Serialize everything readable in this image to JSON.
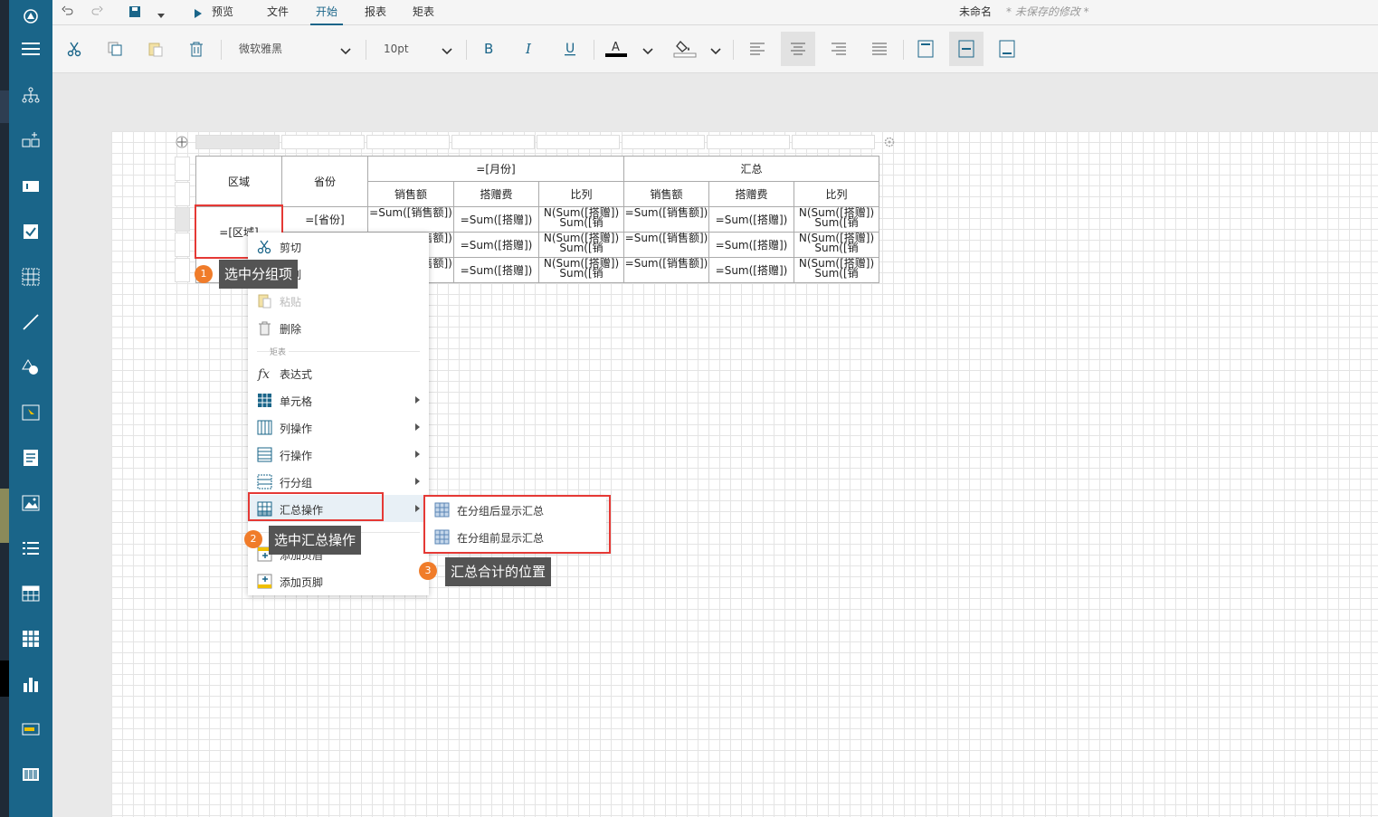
{
  "menubar": {
    "preview": "预览",
    "tabs": [
      "文件",
      "开始",
      "报表",
      "矩表"
    ],
    "doc_name": "未命名",
    "unsaved": "* 未保存的修改 *"
  },
  "toolbar": {
    "font_family": "微软雅黑",
    "font_size": "10pt",
    "accent": "#1a6589"
  },
  "sidebar": {
    "items": [
      "logo-icon",
      "menu-icon",
      "hierarchy-icon",
      "add-grid-icon",
      "textbox-icon",
      "checkbox-icon",
      "table-icon",
      "line-icon",
      "shapes-icon",
      "cursor-icon",
      "document-icon",
      "image-icon",
      "list-icon",
      "tablix-icon",
      "matrix-icon",
      "bar-chart-icon",
      "bullet-icon",
      "barcode-icon"
    ]
  },
  "matrix": {
    "header_region": "区域",
    "header_province": "省份",
    "header_month": "=[月份]",
    "header_total": "汇总",
    "sub_headers": [
      "销售额",
      "搭赠费",
      "比列",
      "销售额",
      "搭赠费",
      "比列"
    ],
    "cell_region": "=[区域]",
    "cell_province": "=[省份]",
    "cell_sales": "=Sum([销售额])",
    "cell_gift": "=Sum([搭赠])",
    "cell_ratio": "N(Sum([搭赠]) Sum([销"
  },
  "context_menu": {
    "cut": "剪切",
    "copy": "复制",
    "paste": "粘贴",
    "delete": "删除",
    "section_matrix": "矩表",
    "expression": "表达式",
    "cell": "单元格",
    "column_ops": "列操作",
    "row_ops": "行操作",
    "row_group": "行分组",
    "total_ops": "汇总操作",
    "section_report": "报表",
    "add_header": "添加页眉",
    "add_footer": "添加页脚"
  },
  "submenu": {
    "after_group": "在分组后显示汇总",
    "before_group": "在分组前显示汇总"
  },
  "annotations": [
    {
      "num": "1",
      "text": "选中分组项"
    },
    {
      "num": "2",
      "text": "选中汇总操作"
    },
    {
      "num": "3",
      "text": "汇总合计的位置"
    }
  ]
}
